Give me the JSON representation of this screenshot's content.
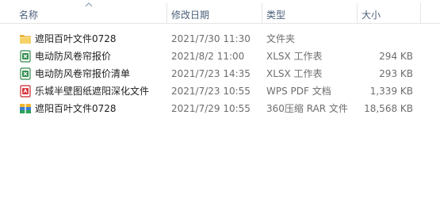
{
  "columns": {
    "name": "名称",
    "date": "修改日期",
    "type": "类型",
    "size": "大小"
  },
  "files": [
    {
      "icon": "folder-icon",
      "name": "遮阳百叶文件0728",
      "date": "2021/7/30 11:30",
      "type": "文件夹",
      "size": ""
    },
    {
      "icon": "xlsx-icon",
      "name": "电动防风卷帘报价",
      "date": "2021/8/2 11:00",
      "type": "XLSX 工作表",
      "size": "294 KB"
    },
    {
      "icon": "xlsx-icon",
      "name": "电动防风卷帘报价清单",
      "date": "2021/7/23 14:35",
      "type": "XLSX 工作表",
      "size": "293 KB"
    },
    {
      "icon": "pdf-icon",
      "name": "乐城半壁图纸遮阳深化文件",
      "date": "2021/7/23 10:55",
      "type": "WPS PDF 文档",
      "size": "1,339 KB"
    },
    {
      "icon": "rar-icon",
      "name": "遮阳百叶文件0728",
      "date": "2021/7/29 10:55",
      "type": "360压缩 RAR 文件",
      "size": "18,568 KB"
    }
  ]
}
